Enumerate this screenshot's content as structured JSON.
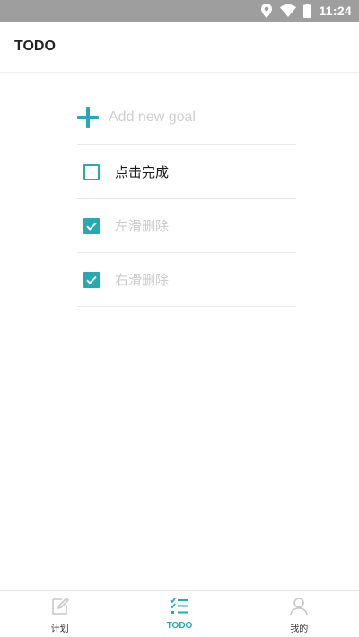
{
  "status_bar": {
    "time": "11:24"
  },
  "app_bar": {
    "title": "TODO"
  },
  "add_goal": {
    "placeholder": "Add new goal",
    "value": ""
  },
  "todos": [
    {
      "text": "点击完成",
      "done": false
    },
    {
      "text": "左滑删除",
      "done": true
    },
    {
      "text": "右滑删除",
      "done": true
    }
  ],
  "bottom_nav": {
    "items": [
      {
        "label": "计划",
        "icon": "edit-icon",
        "active": false
      },
      {
        "label": "TODO",
        "icon": "checklist-icon",
        "active": true
      },
      {
        "label": "我的",
        "icon": "person-icon",
        "active": false
      }
    ]
  },
  "colors": {
    "accent": "#26a9b2",
    "status_bar": "#9e9e9e",
    "done_text": "#cccccc",
    "inactive_icon": "#c8c8c8"
  }
}
